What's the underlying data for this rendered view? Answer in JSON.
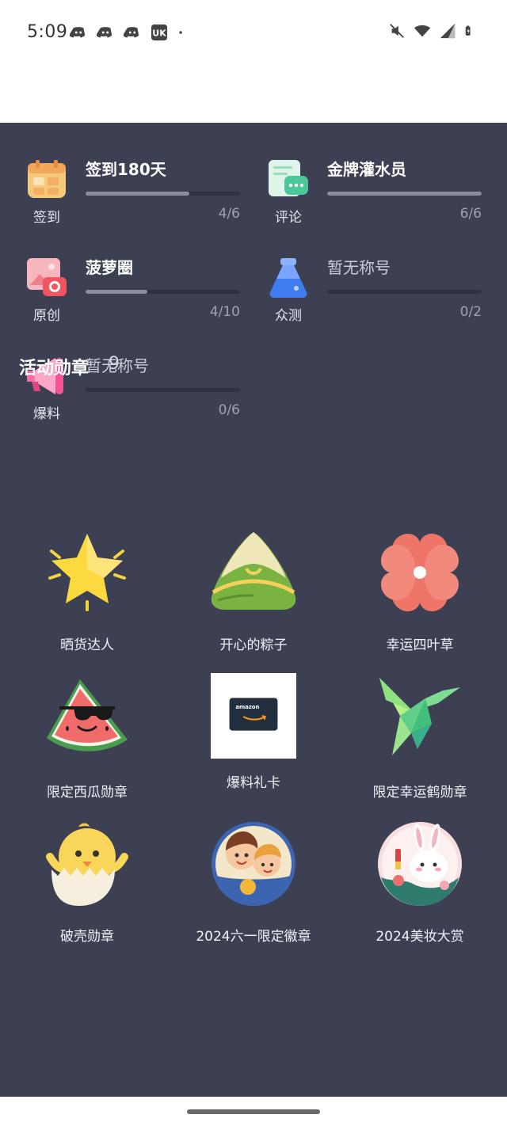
{
  "status": {
    "time": "5:09",
    "left_icons": [
      "discord-icon",
      "discord-icon",
      "discord-icon",
      "uk-app-icon",
      "dot-icon"
    ],
    "right_icons": [
      "mute-icon",
      "wifi-icon",
      "signal-icon",
      "battery-icon"
    ]
  },
  "levels": [
    {
      "category": "签到",
      "title": "签到180天",
      "count": "4/6",
      "progress": 0.67,
      "icon": "calendar-icon"
    },
    {
      "category": "评论",
      "title": "金牌灌水员",
      "count": "6/6",
      "progress": 1.0,
      "icon": "comment-icon"
    },
    {
      "category": "原创",
      "title": "菠萝圈",
      "count": "4/10",
      "progress": 0.4,
      "icon": "photo-icon"
    },
    {
      "category": "众测",
      "title": "暂无称号",
      "count": "0/2",
      "progress": 0,
      "icon": "flask-icon"
    },
    {
      "category": "爆料",
      "title": "暂无称号",
      "count": "0/6",
      "progress": 0,
      "icon": "megaphone-icon"
    }
  ],
  "activity": {
    "title": "活动勋章",
    "count": "9",
    "medals": [
      {
        "name": "晒货达人",
        "icon": "star-icon"
      },
      {
        "name": "开心的粽子",
        "icon": "zongzi-icon"
      },
      {
        "name": "幸运四叶草",
        "icon": "clover-icon"
      },
      {
        "name": "限定西瓜勋章",
        "icon": "watermelon-icon"
      },
      {
        "name": "爆料礼卡",
        "icon": "amazon-card-icon"
      },
      {
        "name": "限定幸运鹤勋章",
        "icon": "crane-icon"
      },
      {
        "name": "破壳勋章",
        "icon": "chick-icon"
      },
      {
        "name": "2024六一限定徽章",
        "icon": "kids-badge-icon"
      },
      {
        "name": "2024美妆大赏",
        "icon": "bunny-badge-icon"
      }
    ]
  },
  "card_text": "amazon"
}
